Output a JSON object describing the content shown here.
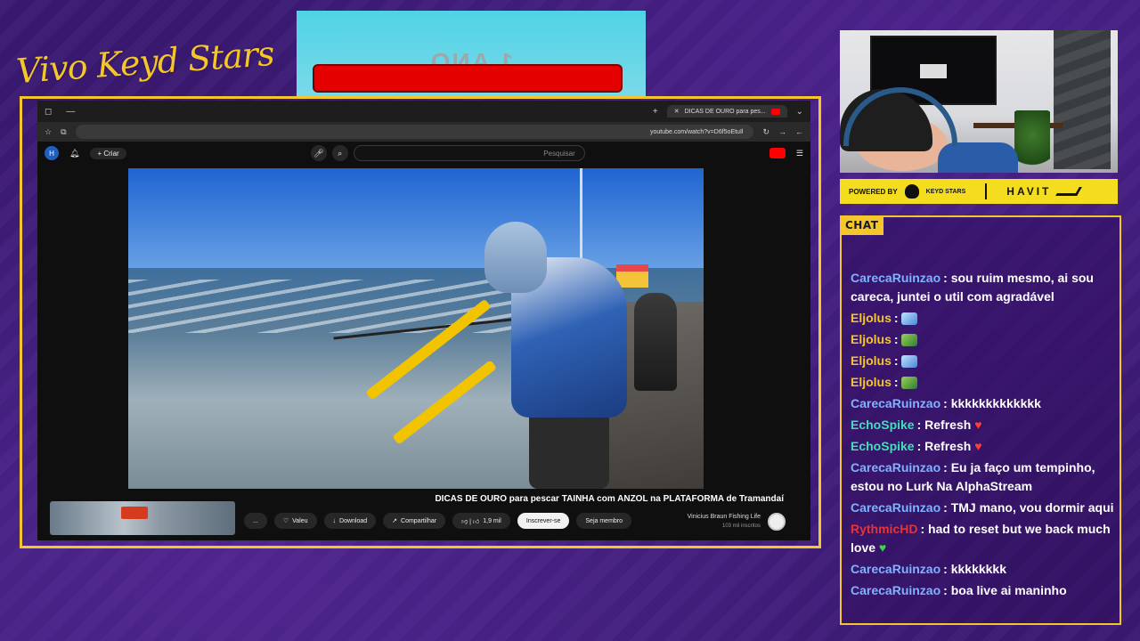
{
  "overlay": {
    "logo_text": "Vivo Keyd Stars",
    "banner_text": "1 ANO"
  },
  "browser": {
    "tab_title": "DICAS DE OURO para pes...",
    "url": "youtube.com/watch?v=D6f5oEtuIl",
    "search_placeholder": "Pesquisar",
    "create_label": "Criar",
    "avatar_initial": "H"
  },
  "video": {
    "title": "DICAS DE OURO para pescar TAINHA com ANZOL na PLATAFORMA de Tramandaí",
    "channel_name": "Vinicius Braun Fishing Life",
    "subscribers": "103 mil inscritos",
    "member_label": "Seja membro",
    "subscribe_label": "Inscrever-se",
    "likes": "1,9 mil",
    "share_label": "Compartilhar",
    "download_label": "Download",
    "thanks_label": "Valeu",
    "more_label": "..."
  },
  "sponsor": {
    "powered_by": "POWERED BY",
    "keyd_text": "KEYD STARS",
    "havit": "HAVIT"
  },
  "chat": {
    "header": "CHAT",
    "messages": [
      {
        "user": "CarecaRuinzao",
        "color": "#7fb2ff",
        "text": "sou ruim mesmo, ai sou careca, juntei o util com agradável",
        "emote": ""
      },
      {
        "user": "Eljolus",
        "color": "#f4c62b",
        "text": "",
        "emote": "fish"
      },
      {
        "user": "Eljolus",
        "color": "#f4c62b",
        "text": "",
        "emote": "croc"
      },
      {
        "user": "Eljolus",
        "color": "#f4c62b",
        "text": "",
        "emote": "fish"
      },
      {
        "user": "Eljolus",
        "color": "#f4c62b",
        "text": "",
        "emote": "croc"
      },
      {
        "user": "CarecaRuinzao",
        "color": "#7fb2ff",
        "text": "kkkkkkkkkkkkk",
        "emote": ""
      },
      {
        "user": "EchoSpike",
        "color": "#3fe0b8",
        "text": "Refresh",
        "emote": "heart-red"
      },
      {
        "user": "EchoSpike",
        "color": "#3fe0b8",
        "text": "Refresh",
        "emote": "heart-red"
      },
      {
        "user": "CarecaRuinzao",
        "color": "#7fb2ff",
        "text": "Eu ja faço um tempinho, estou no Lurk Na AlphaStream",
        "emote": ""
      },
      {
        "user": "CarecaRuinzao",
        "color": "#7fb2ff",
        "text": "TMJ mano, vou dormir aqui",
        "emote": ""
      },
      {
        "user": "RythmicHD",
        "color": "#e0353b",
        "text": "had to reset but we back much love",
        "emote": "heart-green"
      },
      {
        "user": "CarecaRuinzao",
        "color": "#7fb2ff",
        "text": "kkkkkkkk",
        "emote": ""
      },
      {
        "user": "CarecaRuinzao",
        "color": "#7fb2ff",
        "text": "boa live ai maninho",
        "emote": ""
      }
    ]
  }
}
